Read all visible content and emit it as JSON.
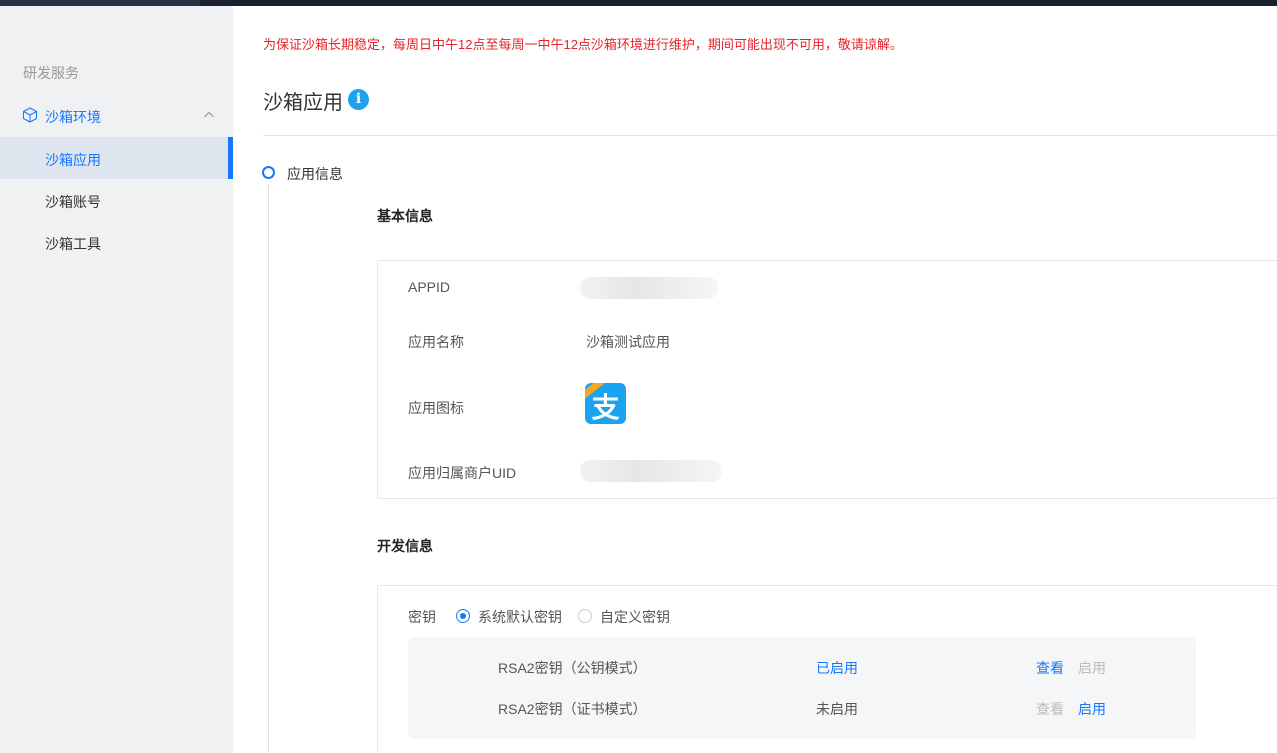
{
  "sidebar": {
    "section_title": "研发服务",
    "group_label": "沙箱环境",
    "items": [
      {
        "label": "沙箱应用",
        "active": true
      },
      {
        "label": "沙箱账号",
        "active": false
      },
      {
        "label": "沙箱工具",
        "active": false
      }
    ]
  },
  "notice": "为保证沙箱长期稳定，每周日中午12点至每周一中午12点沙箱环境进行维护，期间可能出现不可用，敬请谅解。",
  "page_title": "沙箱应用",
  "info_icon_glyph": "i",
  "step": {
    "label": "应用信息"
  },
  "basic": {
    "title": "基本信息",
    "appid_label": "APPID",
    "name_label": "应用名称",
    "name_value": "沙箱测试应用",
    "icon_label": "应用图标",
    "icon_glyph": "支",
    "uid_label": "应用归属商户UID"
  },
  "dev": {
    "title": "开发信息",
    "key_label": "密钥",
    "radio_default": "系统默认密钥",
    "radio_custom": "自定义密钥",
    "selected": "系统默认密钥",
    "keys": [
      {
        "name": "RSA2密钥（公钥模式）",
        "status": "已启用",
        "view": "查看",
        "enable": "启用"
      },
      {
        "name": "RSA2密钥（证书模式）",
        "status": "未启用",
        "view": "查看",
        "enable": "启用"
      }
    ]
  },
  "colors": {
    "accent": "#1677ff",
    "notice": "#e4232b",
    "sidebar_bg": "#f0f1f3"
  }
}
